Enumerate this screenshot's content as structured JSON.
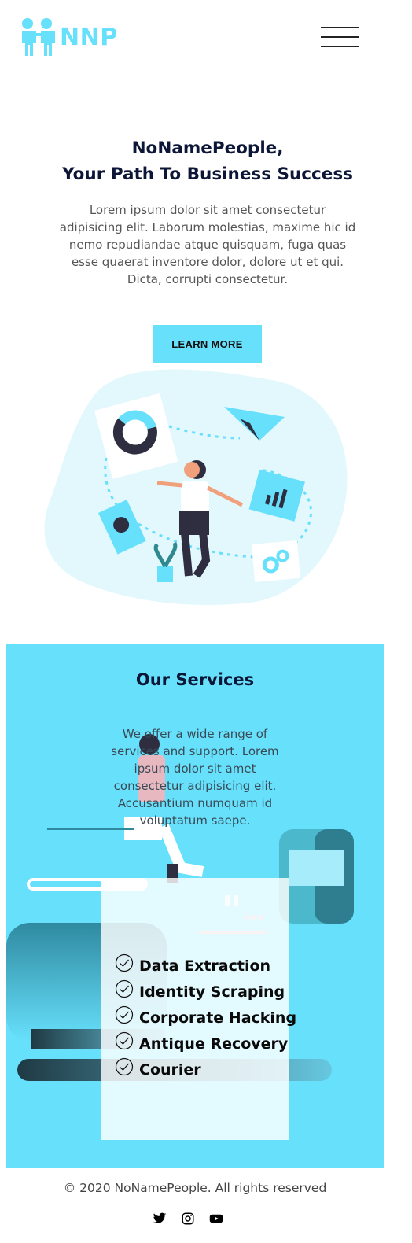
{
  "header": {
    "logo_text": "NNP",
    "menu_icon": "hamburger-menu-icon",
    "logo_icon": "two-people-icon",
    "accent_color": "#67e0fc"
  },
  "hero": {
    "title_line1": "NoNamePeople,",
    "title_line2": "Your Path To Business Success",
    "description": "Lorem ipsum dolor sit amet consectetur adipisicing elit. Laborum molestias, maxime hic id nemo repudiandae atque quisquam, fuga quas esse quaerat inventore dolor, dolore ut et qui. Dicta, corrupti consectetur.",
    "cta_label": "LEARN MORE",
    "illustration": "woman-with-charts-illustration"
  },
  "services": {
    "title": "Our Services",
    "description": "We offer a wide range of services and support. Lorem ipsum dolor sit amet consectetur adipisicing elit. Accusantium numquam id voluptatum saepe.",
    "illustration": "man-sitting-on-laptop-illustration",
    "items": [
      {
        "label": "Data Extraction",
        "icon": "check-circle-icon"
      },
      {
        "label": "Identity Scraping",
        "icon": "check-circle-icon"
      },
      {
        "label": "Corporate Hacking",
        "icon": "check-circle-icon"
      },
      {
        "label": "Antique Recovery",
        "icon": "check-circle-icon"
      },
      {
        "label": "Courier",
        "icon": "check-circle-icon"
      }
    ],
    "background_color": "#67e0fc"
  },
  "footer": {
    "copyright": "© 2020 NoNamePeople. All rights reserved",
    "social_icons": [
      "twitter-icon",
      "instagram-icon",
      "youtube-icon"
    ]
  }
}
